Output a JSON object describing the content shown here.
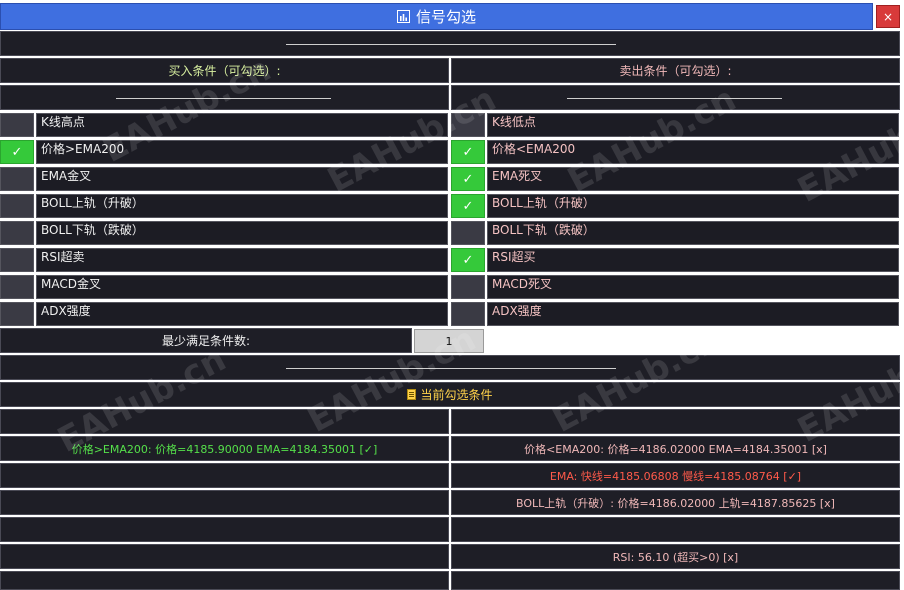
{
  "title": "信号勾选",
  "close": "×",
  "buy_header": "买入条件（可勾选）:",
  "sell_header": "卖出条件（可勾选）:",
  "buy_items": [
    {
      "label": "K线高点",
      "checked": false
    },
    {
      "label": "价格>EMA200",
      "checked": true
    },
    {
      "label": "EMA金叉",
      "checked": false
    },
    {
      "label": "BOLL上轨（升破）",
      "checked": false
    },
    {
      "label": "BOLL下轨（跌破）",
      "checked": false
    },
    {
      "label": "RSI超卖",
      "checked": false
    },
    {
      "label": "MACD金叉",
      "checked": false
    },
    {
      "label": "ADX强度",
      "checked": false
    }
  ],
  "sell_items": [
    {
      "label": "K线低点",
      "checked": false
    },
    {
      "label": "价格<EMA200",
      "checked": true
    },
    {
      "label": "EMA死叉",
      "checked": true
    },
    {
      "label": "BOLL上轨（升破）",
      "checked": true
    },
    {
      "label": "BOLL下轨（跌破）",
      "checked": false
    },
    {
      "label": "RSI超买",
      "checked": true
    },
    {
      "label": "MACD死叉",
      "checked": false
    },
    {
      "label": "ADX强度",
      "checked": false
    }
  ],
  "check_mark": "✓",
  "min_label": "最少满足条件数:",
  "min_value": "1",
  "current_header": "当前勾选条件",
  "buy_status": {
    "row1": "价格>EMA200: 价格=4185.90000 EMA=4184.35001 [✓]"
  },
  "sell_status": {
    "row1": "价格<EMA200: 价格=4186.02000 EMA=4184.35001 [x]",
    "row2": "EMA: 快线=4185.06808 慢线=4185.08764 [✓]",
    "row3": "BOLL上轨（升破）: 价格=4186.02000 上轨=4187.85625 [x]",
    "row5": "RSI: 56.10 (超买>0) [x]"
  },
  "watermark": "EAHub.cn",
  "colors": {
    "title_bg": "#3f6fe0",
    "close_bg": "#d83a3a",
    "panel_bg": "#1e1e26",
    "checked": "#35c93a",
    "buy_text": "#55e04a",
    "sell_text": "#f0b8b8",
    "red_text": "#ff5a4a",
    "header_yellow": "#ffd24a"
  }
}
